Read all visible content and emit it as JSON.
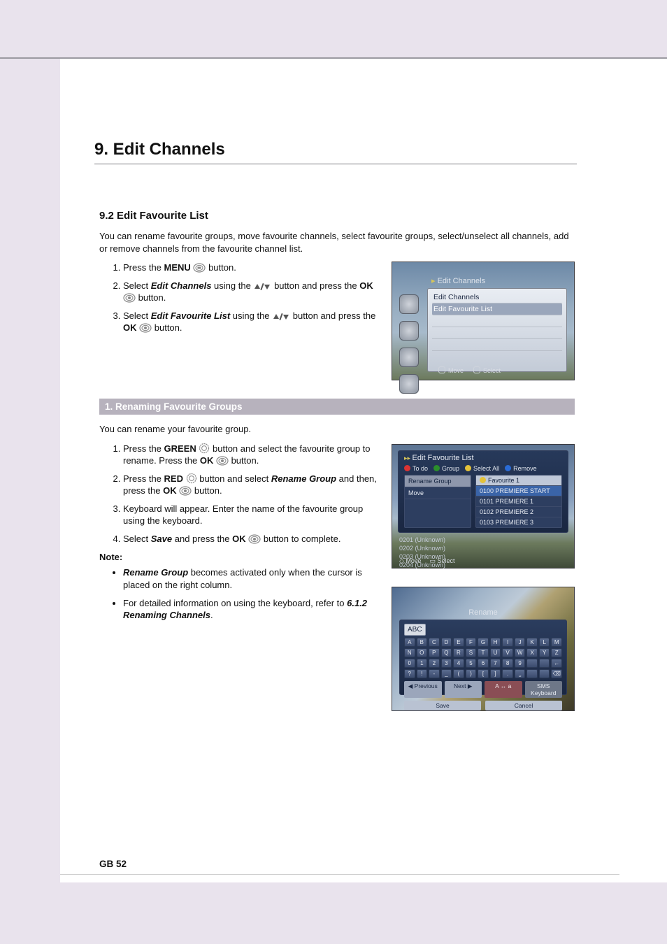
{
  "chapter_title": "9. Edit Channels",
  "section_title": "9.2 Edit Favourite List",
  "intro": "You can rename favourite groups, move favourite channels, select favourite groups, select/unselect all channels, add or remove channels from the favourite channel list.",
  "steps_a": {
    "s1_a": "Press the ",
    "s1_b": "MENU",
    "s1_c": " button.",
    "s2_a": "Select ",
    "s2_b": "Edit Channels",
    "s2_c": " using the ",
    "s2_d": " button and press the ",
    "s2_e": "OK",
    "s2_f": " button.",
    "s3_a": "Select ",
    "s3_b": "Edit Favourite List",
    "s3_c": " using the ",
    "s3_d": " button and press the ",
    "s3_e": "OK",
    "s3_f": " button."
  },
  "sub1_title": "1. Renaming Favourite Groups",
  "sub1_intro": "You can rename your favourite group.",
  "steps_b": {
    "s1_a": "Press the ",
    "s1_b": "GREEN",
    "s1_c": " button and select the favourite group to rename. Press the ",
    "s1_d": "OK",
    "s1_e": " button.",
    "s2_a": "Press the ",
    "s2_b": "RED",
    "s2_c": " button and select ",
    "s2_d": "Rename Group",
    "s2_e": " and then, press the ",
    "s2_f": "OK",
    "s2_g": " button.",
    "s3": "Keyboard will appear. Enter the name of the favourite group using the keyboard.",
    "s4_a": "Select ",
    "s4_b": "Save",
    "s4_c": " and press the ",
    "s4_d": "OK",
    "s4_e": " button to complete."
  },
  "note_label": "Note:",
  "notes": {
    "n1_a": "Rename Group",
    "n1_b": " becomes activated only when the cursor is placed on the right column.",
    "n2_a": "For detailed information on using the keyboard, refer to ",
    "n2_b": "6.1.2 Renaming Channels",
    "n2_c": "."
  },
  "screenshot1": {
    "title": "Edit Channels",
    "rows": [
      "Edit Channels",
      "Edit Favourite List"
    ],
    "footer": [
      "Move",
      "Select"
    ]
  },
  "screenshot2": {
    "title": "Edit Favourite List",
    "tabs": [
      {
        "color": "r",
        "label": "To do"
      },
      {
        "color": "g",
        "label": "Group"
      },
      {
        "color": "y",
        "label": "Select All"
      },
      {
        "color": "b",
        "label": "Remove"
      }
    ],
    "left_opts": [
      "Rename Group",
      "Move"
    ],
    "right_header": "Favourite 1",
    "right_rows": [
      "0100  PREMIERE START",
      "0101  PREMIERE 1",
      "0102  PREMIERE 2",
      "0103  PREMIERE 3"
    ],
    "bottom_list": [
      "0201 (Unknown)",
      "0202 (Unknown)",
      "0203 (Unknown)",
      "0204 (Unknown)"
    ],
    "footer": [
      "Move",
      "Select"
    ]
  },
  "screenshot3": {
    "title": "Rename",
    "field": "ABC",
    "rows": [
      [
        "A",
        "B",
        "C",
        "D",
        "E",
        "F",
        "G",
        "H",
        "I",
        "J",
        "K",
        "L",
        "M"
      ],
      [
        "N",
        "O",
        "P",
        "Q",
        "R",
        "S",
        "T",
        "U",
        "V",
        "W",
        "X",
        "Y",
        "Z"
      ],
      [
        "0",
        "1",
        "2",
        "3",
        "4",
        "5",
        "6",
        "7",
        "8",
        "9",
        " ",
        " ",
        "←"
      ],
      [
        "?",
        "!",
        "-",
        "_",
        "(",
        ")",
        "[",
        "]",
        ".",
        "⎵",
        " ",
        " ",
        "⌫"
      ]
    ],
    "btns": [
      "◀ Previous",
      "Next ▶",
      "A ↔ a",
      "SMS Keyboard"
    ],
    "save": [
      "Save",
      "Cancel"
    ]
  },
  "page_number": "GB 52"
}
